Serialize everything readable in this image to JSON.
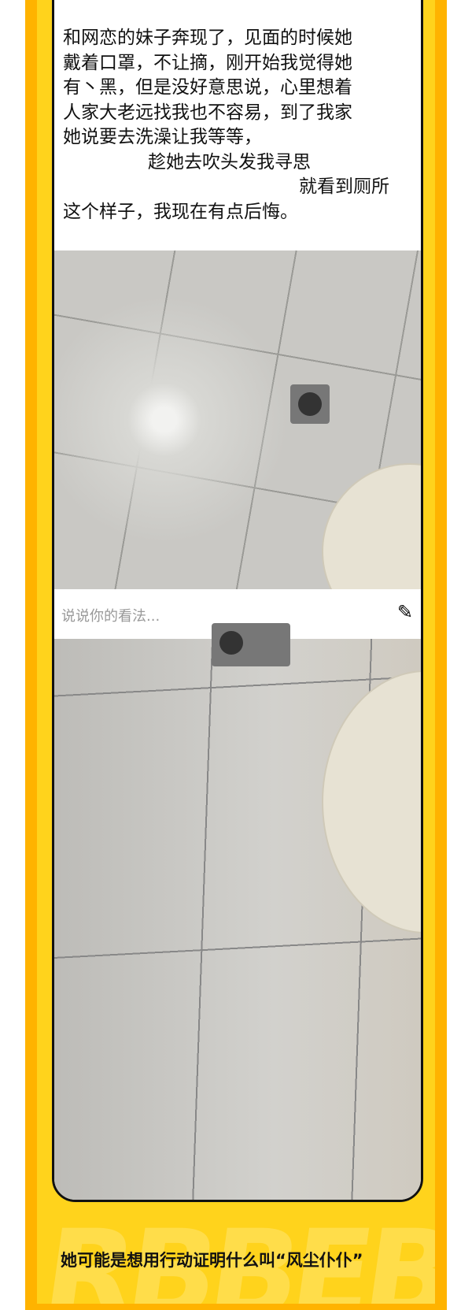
{
  "story": {
    "lines": [
      "和网恋的妹子奔现了，见面的时候她",
      "戴着口罩，不让摘，刚开始我觉得她",
      "有丶黑，但是没好意思说，心里想着",
      "人家大老远找我也不容易，到了我家",
      "她说要去洗澡让我等等，",
      "趁她去吹头发我寻思",
      "就看到厕所",
      "这个样子，我现在有点后悔。"
    ]
  },
  "comment": {
    "placeholder": "说说你的看法...",
    "sticker_icon": "meme-sticker-icon"
  },
  "caption": "她可能是想用行动证明什么叫“风尘仆仆”",
  "watermark": "RBBEB",
  "colors": {
    "outer_border": "#FFB300",
    "background": "#FFD31C"
  }
}
